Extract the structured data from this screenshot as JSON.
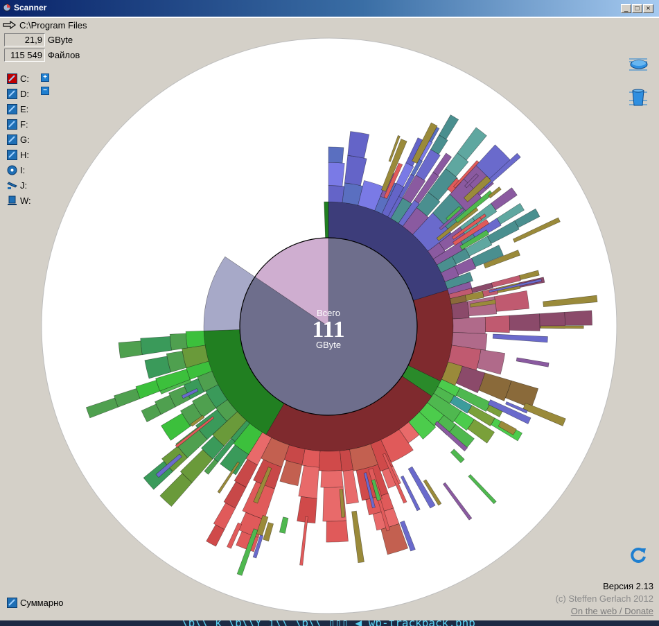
{
  "window": {
    "title": "Scanner",
    "controls": [
      "_",
      "□",
      "×"
    ]
  },
  "path": {
    "value": "C:\\Program Files"
  },
  "stats": {
    "size_value": "21,9",
    "size_unit": "GByte",
    "files_value": "115 549",
    "files_label": "Файлов"
  },
  "drives": [
    {
      "label": "C:",
      "type": "hdd-selected",
      "icon": "hard-drive-icon",
      "color": "#c00000"
    },
    {
      "label": "D:",
      "type": "hdd",
      "icon": "hard-drive-icon",
      "color": "#1f6fb5"
    },
    {
      "label": "E:",
      "type": "hdd",
      "icon": "hard-drive-icon",
      "color": "#1f6fb5"
    },
    {
      "label": "F:",
      "type": "hdd",
      "icon": "hard-drive-icon",
      "color": "#1f6fb5"
    },
    {
      "label": "G:",
      "type": "hdd",
      "icon": "hard-drive-icon",
      "color": "#1f6fb5"
    },
    {
      "label": "H:",
      "type": "hdd",
      "icon": "hard-drive-icon",
      "color": "#1f6fb5"
    },
    {
      "label": "I:",
      "type": "cd",
      "icon": "cd-icon",
      "color": "#1f6fb5"
    },
    {
      "label": "J:",
      "type": "removable",
      "icon": "usb-drive-icon",
      "color": "#1f6fb5"
    },
    {
      "label": "W:",
      "type": "network",
      "icon": "network-drive-icon",
      "color": "#1f6fb5"
    }
  ],
  "zoom": {
    "in": "+",
    "out": "−"
  },
  "center": {
    "label": "Всего",
    "value": "111",
    "unit": "GByte"
  },
  "summary": {
    "label": "Суммарно"
  },
  "footer": {
    "version": "Версия 2.13",
    "copyright": "(c) Steffen Gerlach 2012",
    "link": "On the web / Donate"
  },
  "taskbar": {
    "text": "\\b\\\\ k  \\b\\\\Y i\\\\ \\b\\\\ ▯▯▯ ◀ wp-trackback.php"
  }
}
